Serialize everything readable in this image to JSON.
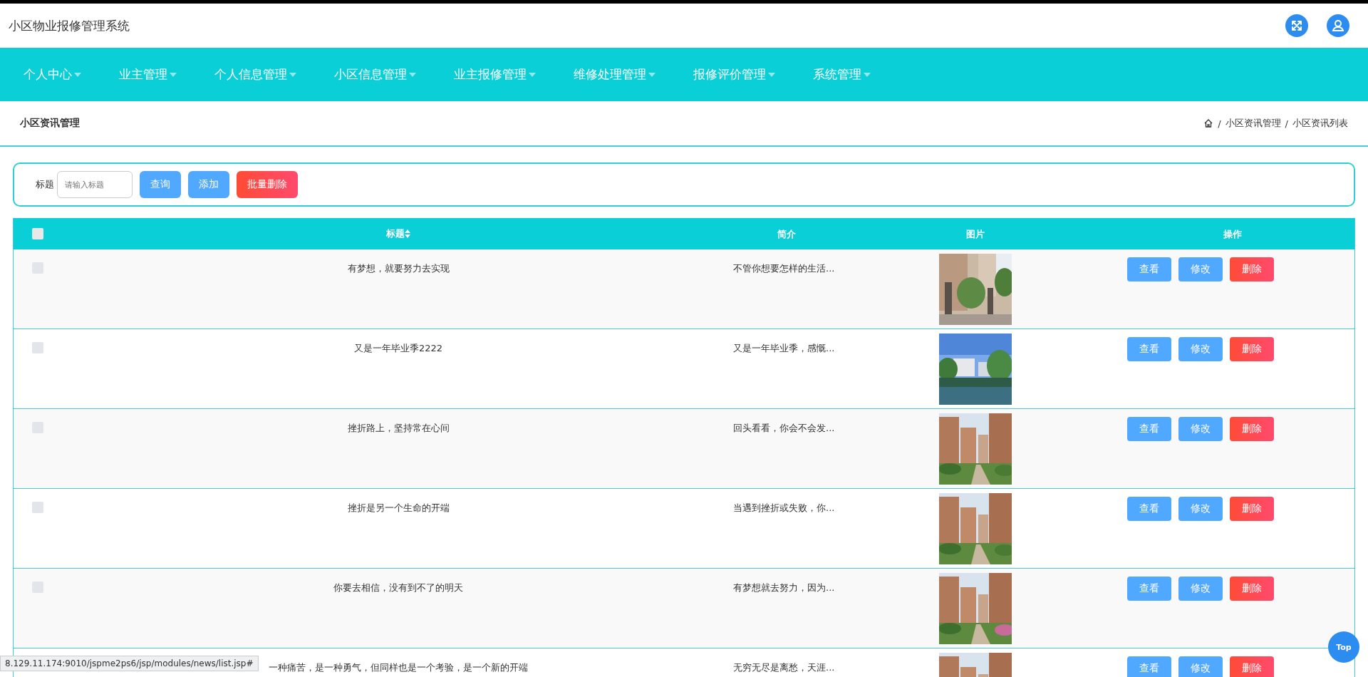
{
  "header": {
    "title": "小区物业报修管理系统"
  },
  "nav": [
    {
      "label": "个人中心"
    },
    {
      "label": "业主管理"
    },
    {
      "label": "个人信息管理"
    },
    {
      "label": "小区信息管理"
    },
    {
      "label": "业主报修管理"
    },
    {
      "label": "维修处理管理"
    },
    {
      "label": "报修评价管理"
    },
    {
      "label": "系统管理"
    }
  ],
  "page_title": "小区资讯管理",
  "breadcrumb": [
    "/",
    "小区资讯管理",
    "/",
    "小区资讯列表"
  ],
  "search": {
    "label": "标题",
    "placeholder": "请输入标题",
    "buttons": [
      {
        "label": "查询",
        "kind": "primary"
      },
      {
        "label": "添加",
        "kind": "primary"
      },
      {
        "label": "批量删除",
        "kind": "danger"
      }
    ]
  },
  "table": {
    "select_all": {
      "checked": false
    },
    "columns": [
      "标题",
      "简介",
      "图片",
      "操作"
    ],
    "rows": [
      {
        "checked": false,
        "title": "有梦想，就要努力去实现",
        "intro": "不管你想要怎样的生活...",
        "actions": [
          "查看",
          "修改",
          "删除"
        ]
      },
      {
        "checked": false,
        "title": "又是一年毕业季2222",
        "intro": "又是一年毕业季，感慨...",
        "actions": [
          "查看",
          "修改",
          "删除"
        ]
      },
      {
        "checked": false,
        "title": "挫折路上，坚持常在心间",
        "intro": "回头看看，你会不会发...",
        "actions": [
          "查看",
          "修改",
          "删除"
        ]
      },
      {
        "checked": false,
        "title": "挫折是另一个生命的开端",
        "intro": "当遇到挫折或失败，你...",
        "actions": [
          "查看",
          "修改",
          "删除"
        ]
      },
      {
        "checked": false,
        "title": "你要去相信，没有到不了的明天",
        "intro": "有梦想就去努力，因为...",
        "actions": [
          "查看",
          "修改",
          "删除"
        ]
      },
      {
        "title": "一种痛苦，是一种勇气，但同样也是一个考验，是一个新的开端",
        "intro": "无穷无尽是离愁，天涯...",
        "actions": [
          "查看",
          "修改",
          "删除"
        ]
      }
    ]
  },
  "status_url": "8.129.11.174:9010/jspme2ps6/jsp/modules/news/list.jsp#",
  "top_button": "Top"
}
